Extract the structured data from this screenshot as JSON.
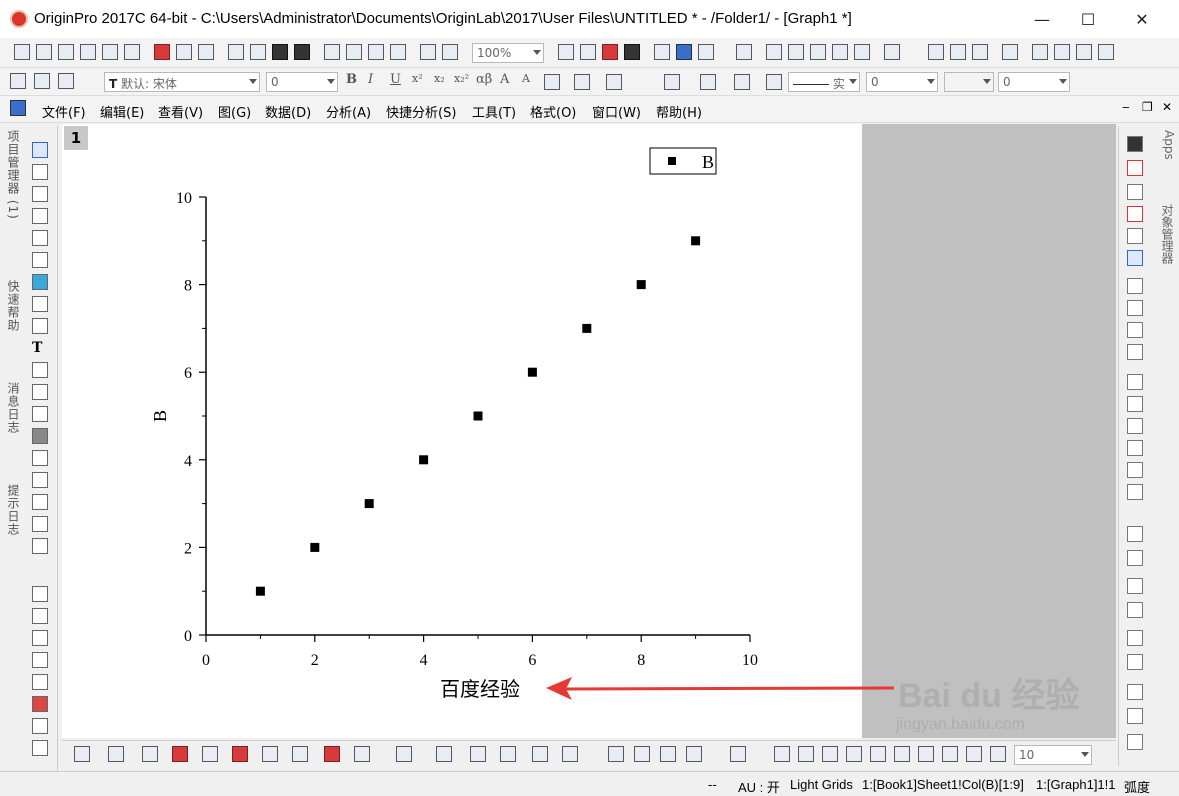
{
  "window": {
    "title": "OriginPro 2017C 64-bit - C:\\Users\\Administrator\\Documents\\OriginLab\\2017\\User Files\\UNTITLED * - /Folder1/ - [Graph1 *]",
    "minimize": "—",
    "maximize": "☐",
    "close": "✕"
  },
  "toolbar1": {
    "zoom": "100%"
  },
  "toolbar2": {
    "font": "默认: 宋体",
    "font_size": "0",
    "bold": "B",
    "italic": "I",
    "underline": "U",
    "superscript": "x²",
    "subscript": "x₂",
    "supsub": "x₂²",
    "greek": "αβ",
    "grow": "A",
    "shrink": "A",
    "line_style": "实",
    "line_width": "0",
    "pattern_value": "0"
  },
  "menu": [
    "文件(F)",
    "编辑(E)",
    "查看(V)",
    "图(G)",
    "数据(D)",
    "分析(A)",
    "快捷分析(S)",
    "工具(T)",
    "格式(O)",
    "窗口(W)",
    "帮助(H)"
  ],
  "left_tabs": [
    "项目管理器 (1)",
    "快速帮助",
    "消息日志",
    "提示日志"
  ],
  "right_tabs": [
    "Apps",
    "对象管理器"
  ],
  "graph": {
    "layer_label": "1",
    "legend_label": "B"
  },
  "chart_data": {
    "type": "scatter",
    "series": [
      {
        "name": "B",
        "x": [
          1,
          2,
          3,
          4,
          5,
          6,
          7,
          8,
          9
        ],
        "y": [
          1,
          2,
          3,
          4,
          5,
          6,
          7,
          8,
          9
        ]
      }
    ],
    "xlabel": "百度经验",
    "ylabel": "B",
    "xlim": [
      0,
      10
    ],
    "ylim": [
      0,
      10
    ],
    "xticks": [
      "0",
      "2",
      "4",
      "6",
      "8",
      "10"
    ],
    "yticks": [
      "0",
      "2",
      "4",
      "6",
      "8",
      "10"
    ],
    "legend": "top-right",
    "marker_color": "#000000",
    "annotation_arrow_color": "#e53935"
  },
  "bottom_toolbar": {
    "zoom_value": "10"
  },
  "status": {
    "dashes": "--",
    "au": "AU : 开",
    "theme": "Light Grids",
    "active_col": "1:[Book1]Sheet1!Col(B)[1:9]",
    "active_graph": "1:[Graph1]1!1",
    "unit": "弧度"
  },
  "watermark": {
    "brand": "Bai du 经验",
    "url": "jingyan.baidu.com"
  }
}
